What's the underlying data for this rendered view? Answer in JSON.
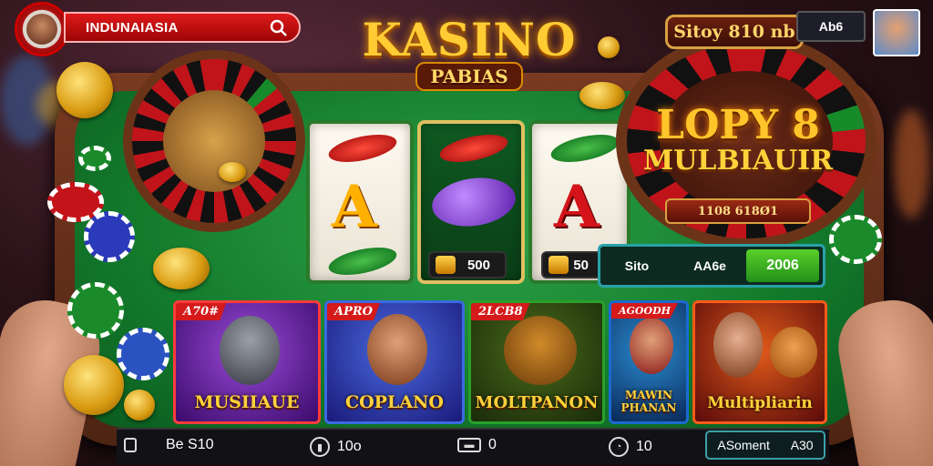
{
  "search": {
    "text": "INDUNAIASIA"
  },
  "logo": {
    "main": "KASINO",
    "sub": "PABIAS"
  },
  "banner_top": "Sitoy 810 nb",
  "top_right": {
    "box_label": "Ab6"
  },
  "feature": {
    "line1": "LOPY 8",
    "line2": "MULBIAUIR",
    "ribbon": "1108 618Ø1"
  },
  "reels": {
    "pill1": "500",
    "pill2": "50"
  },
  "bet_bar": {
    "seg1": "Sito",
    "seg2": "AA6e",
    "seg3": "2006"
  },
  "games": [
    {
      "badge": "A70#",
      "title": "MUSIIAUE"
    },
    {
      "badge": "APRO",
      "title": "COPLANO"
    },
    {
      "badge": "2LCB8",
      "title": "MOLTPANON"
    },
    {
      "badge": "AGOODH",
      "title": "MAWIN PHANAN"
    },
    {
      "badge": "",
      "title": "Multipliarin"
    }
  ],
  "bottom": {
    "item1": "Be  S10",
    "item2": "10o",
    "item3": "0",
    "item4": "10",
    "right_a": "ASoment",
    "right_b": "A30"
  },
  "colors": {
    "accent_red": "#d41a1a",
    "felt_green": "#137a2c",
    "gold": "#ffcc33",
    "teal": "#2aa0a8"
  }
}
